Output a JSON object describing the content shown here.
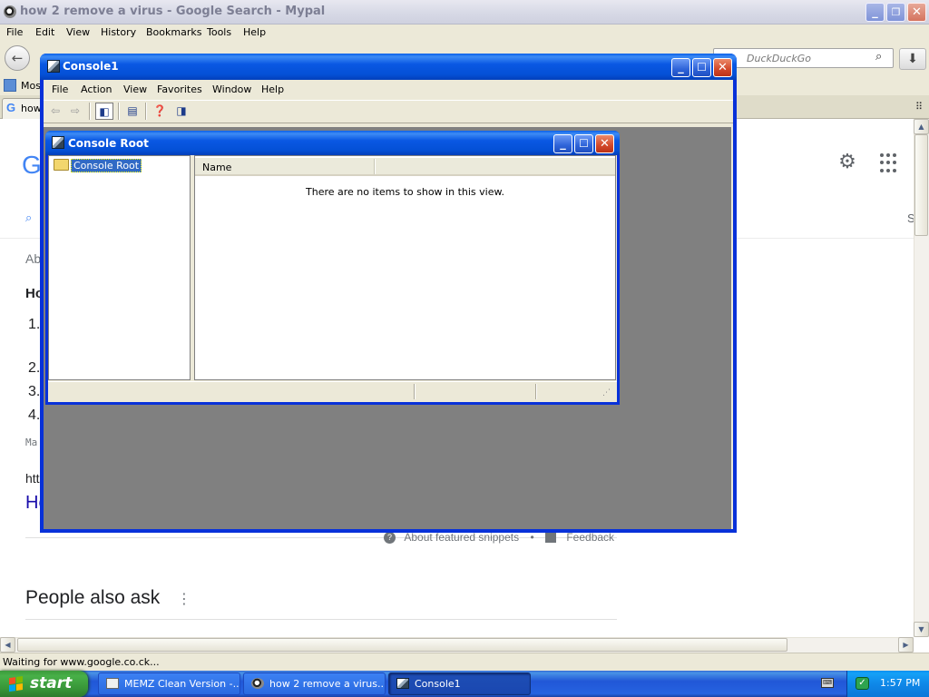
{
  "browser": {
    "title": "how 2 remove a virus - Google Search - Mypal",
    "menu": [
      "File",
      "Edit",
      "View",
      "History",
      "Bookmarks",
      "Tools",
      "Help"
    ],
    "search_placeholder": "DuckDuckGo",
    "bookmark_label": "Most",
    "tab_label": "how",
    "status_text": "Waiting for www.google.co.ck..."
  },
  "google": {
    "logo_letter": "G",
    "tab_letter": "S",
    "results_prefix": "Ab",
    "snippet_heading": "Ho",
    "list_numbers": [
      "1.",
      "2.",
      "3.",
      "4."
    ],
    "small_text": "Ma",
    "url_fragment": "htt",
    "link_fragment": "He",
    "about_snippets": "About featured snippets",
    "bullet": "•",
    "feedback": "Feedback",
    "people_also_ask": "People also ask",
    "kebab": "⋮"
  },
  "console1": {
    "title": "Console1",
    "menu": [
      "File",
      "Action",
      "View",
      "Favorites",
      "Window",
      "Help"
    ]
  },
  "console_root": {
    "title": "Console Root",
    "tree_item": "Console Root",
    "column_name": "Name",
    "empty_message": "There are no items to show in this view."
  },
  "taskbar": {
    "start_label": "start",
    "buttons": [
      {
        "label": "MEMZ Clean Version -..."
      },
      {
        "label": "how 2 remove a virus..."
      },
      {
        "label": "Console1"
      }
    ],
    "clock": "1:57 PM"
  },
  "colors": {
    "xp_blue": "#0831d9",
    "google_blue": "#4285f4",
    "mmc_background": "#808080"
  }
}
